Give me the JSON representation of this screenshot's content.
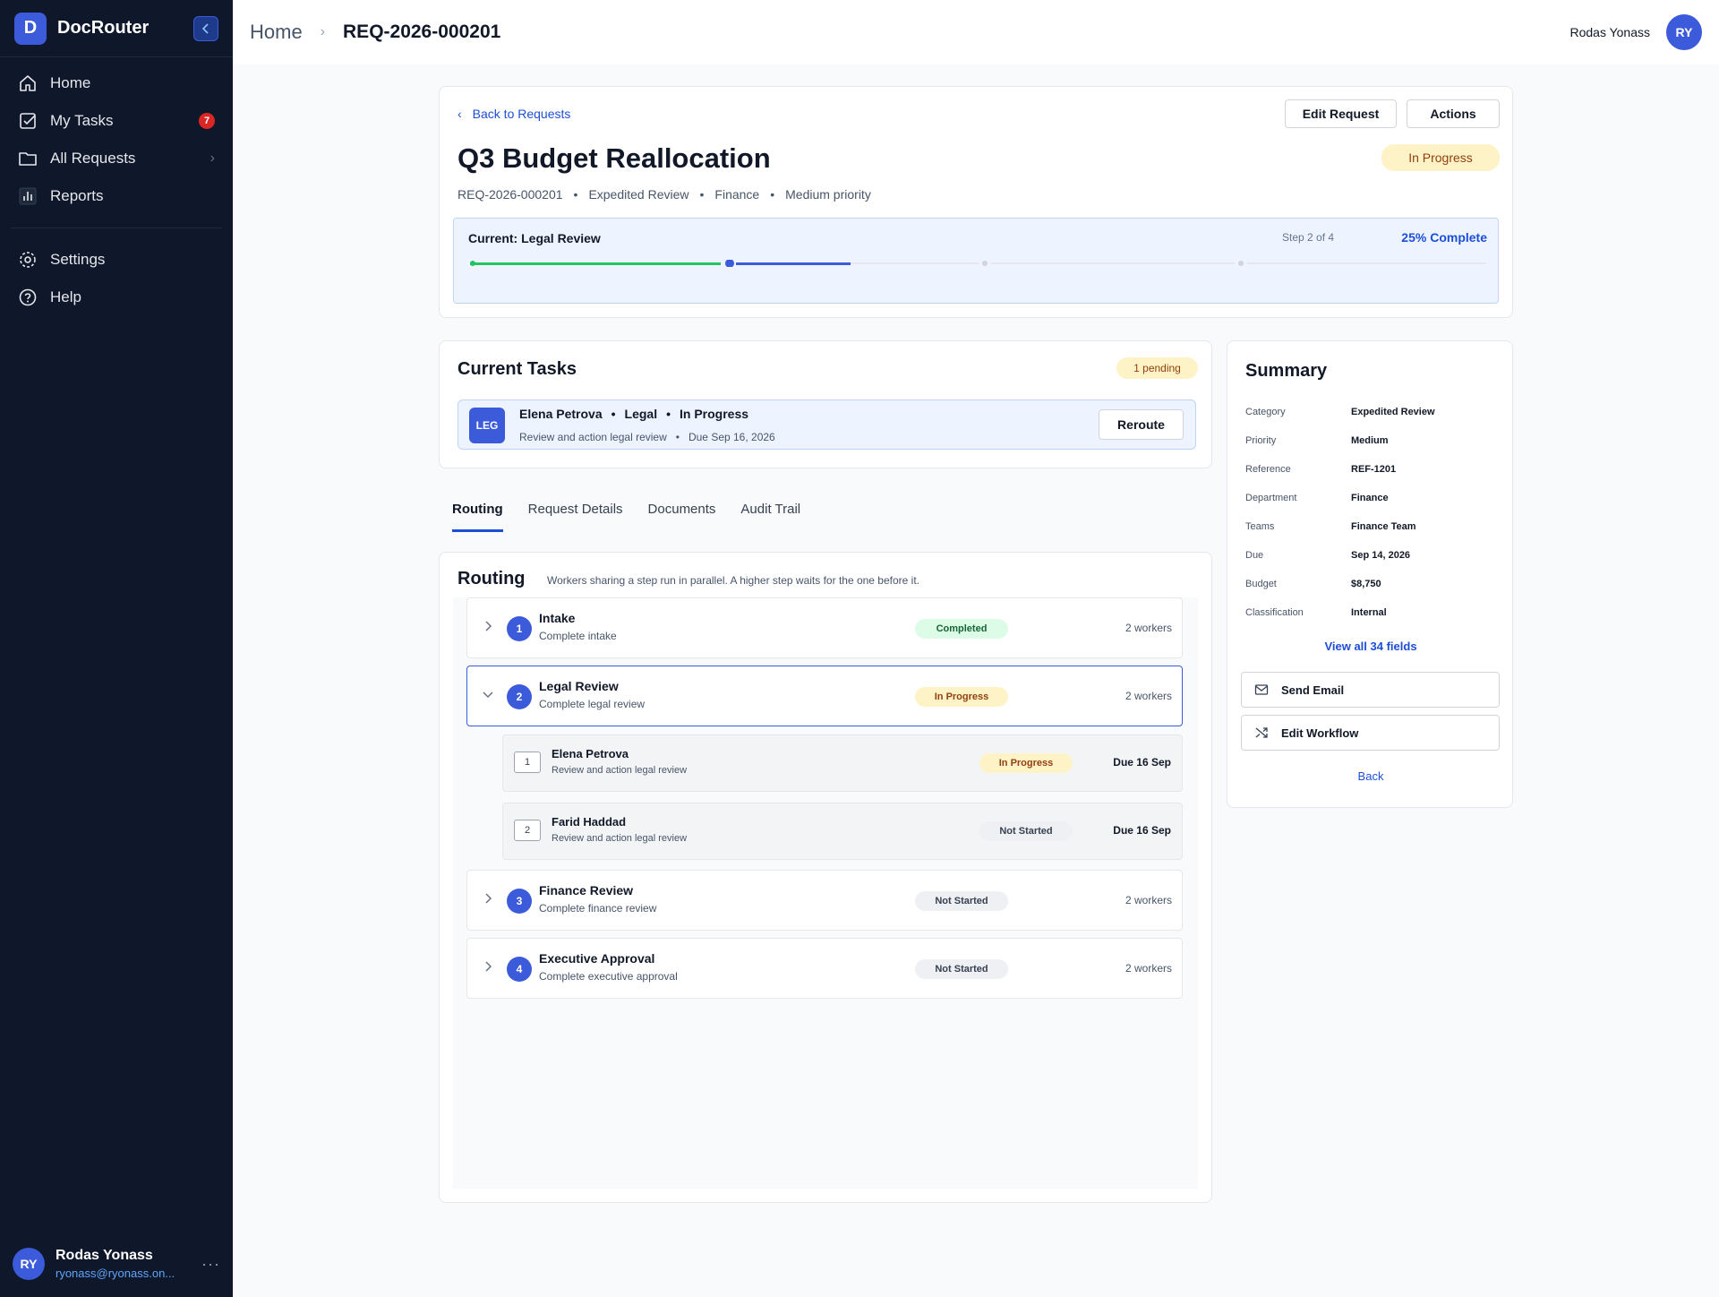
{
  "app": {
    "logo_letter": "D",
    "name": "DocRouter"
  },
  "sidebar": {
    "items": [
      {
        "label": "Home",
        "icon": "home-icon"
      },
      {
        "label": "My Tasks",
        "icon": "task-check-icon",
        "badge": "7"
      },
      {
        "label": "All Requests",
        "icon": "folder-icon",
        "chevron": true
      },
      {
        "label": "Reports",
        "icon": "bar-chart-icon"
      }
    ],
    "secondary": [
      {
        "label": "Settings",
        "icon": "gear-icon"
      },
      {
        "label": "Help",
        "icon": "help-circle-icon"
      }
    ],
    "user": {
      "initials": "RY",
      "name": "Rodas Yonass",
      "email": "ryonass@ryonass.on..."
    }
  },
  "topbar": {
    "breadcrumb_home": "Home",
    "breadcrumb_current": "REQ-2026-000201",
    "user_name": "Rodas Yonass",
    "user_initials": "RY"
  },
  "request": {
    "back_label": "Back to Requests",
    "edit_label": "Edit Request",
    "actions_label": "Actions",
    "title": "Q3 Budget Reallocation",
    "status": "In Progress",
    "meta": [
      "REQ-2026-000201",
      "Expedited Review",
      "Finance",
      "Medium priority"
    ],
    "progress": {
      "current_label": "Current: Legal Review",
      "step_text": "Step 2 of 4",
      "percent_text": "25% Complete",
      "percent": 25
    }
  },
  "current_tasks": {
    "title": "Current Tasks",
    "pending_badge": "1 pending",
    "task": {
      "avatar": "LEG",
      "name": "Elena Petrova",
      "dept": "Legal",
      "status": "In Progress",
      "desc": "Review and action legal review",
      "due": "Due Sep 16, 2026",
      "button": "Reroute"
    }
  },
  "tabs": [
    "Routing",
    "Request Details",
    "Documents",
    "Audit Trail"
  ],
  "routing": {
    "title": "Routing",
    "description": "Workers sharing a step run in parallel. A higher step waits for the one before it.",
    "steps": [
      {
        "num": "1",
        "name": "Intake",
        "sub": "Complete intake",
        "status": "Completed",
        "workers": "2 workers"
      },
      {
        "num": "2",
        "name": "Legal Review",
        "sub": "Complete legal review",
        "status": "In Progress",
        "workers": "2 workers"
      },
      {
        "num": "3",
        "name": "Finance Review",
        "sub": "Complete finance review",
        "status": "Not Started",
        "workers": "2 workers"
      },
      {
        "num": "4",
        "name": "Executive Approval",
        "sub": "Complete executive approval",
        "status": "Not Started",
        "workers": "2 workers"
      }
    ],
    "workers": [
      {
        "num": "1",
        "name": "Elena Petrova",
        "desc": "Review and action legal review",
        "status": "In Progress",
        "due": "Due 16 Sep"
      },
      {
        "num": "2",
        "name": "Farid Haddad",
        "desc": "Review and action legal review",
        "status": "Not Started",
        "due": "Due 16 Sep"
      }
    ]
  },
  "summary": {
    "title": "Summary",
    "fields": [
      {
        "label": "Category",
        "value": "Expedited Review"
      },
      {
        "label": "Priority",
        "value": "Medium"
      },
      {
        "label": "Reference",
        "value": "REF-1201"
      },
      {
        "label": "Department",
        "value": "Finance"
      },
      {
        "label": "Teams",
        "value": "Finance Team"
      },
      {
        "label": "Due",
        "value": "Sep 14, 2026"
      },
      {
        "label": "Budget",
        "value": "$8,750"
      },
      {
        "label": "Classification",
        "value": "Internal"
      }
    ],
    "view_all": "View all 34 fields",
    "send_email": "Send Email",
    "edit_workflow": "Edit Workflow",
    "back": "Back"
  },
  "colors": {
    "accent": "#3b5bdb",
    "link": "#1d4ed8",
    "sidebar_bg": "#0f172a",
    "complete_green": "#22c55e"
  }
}
